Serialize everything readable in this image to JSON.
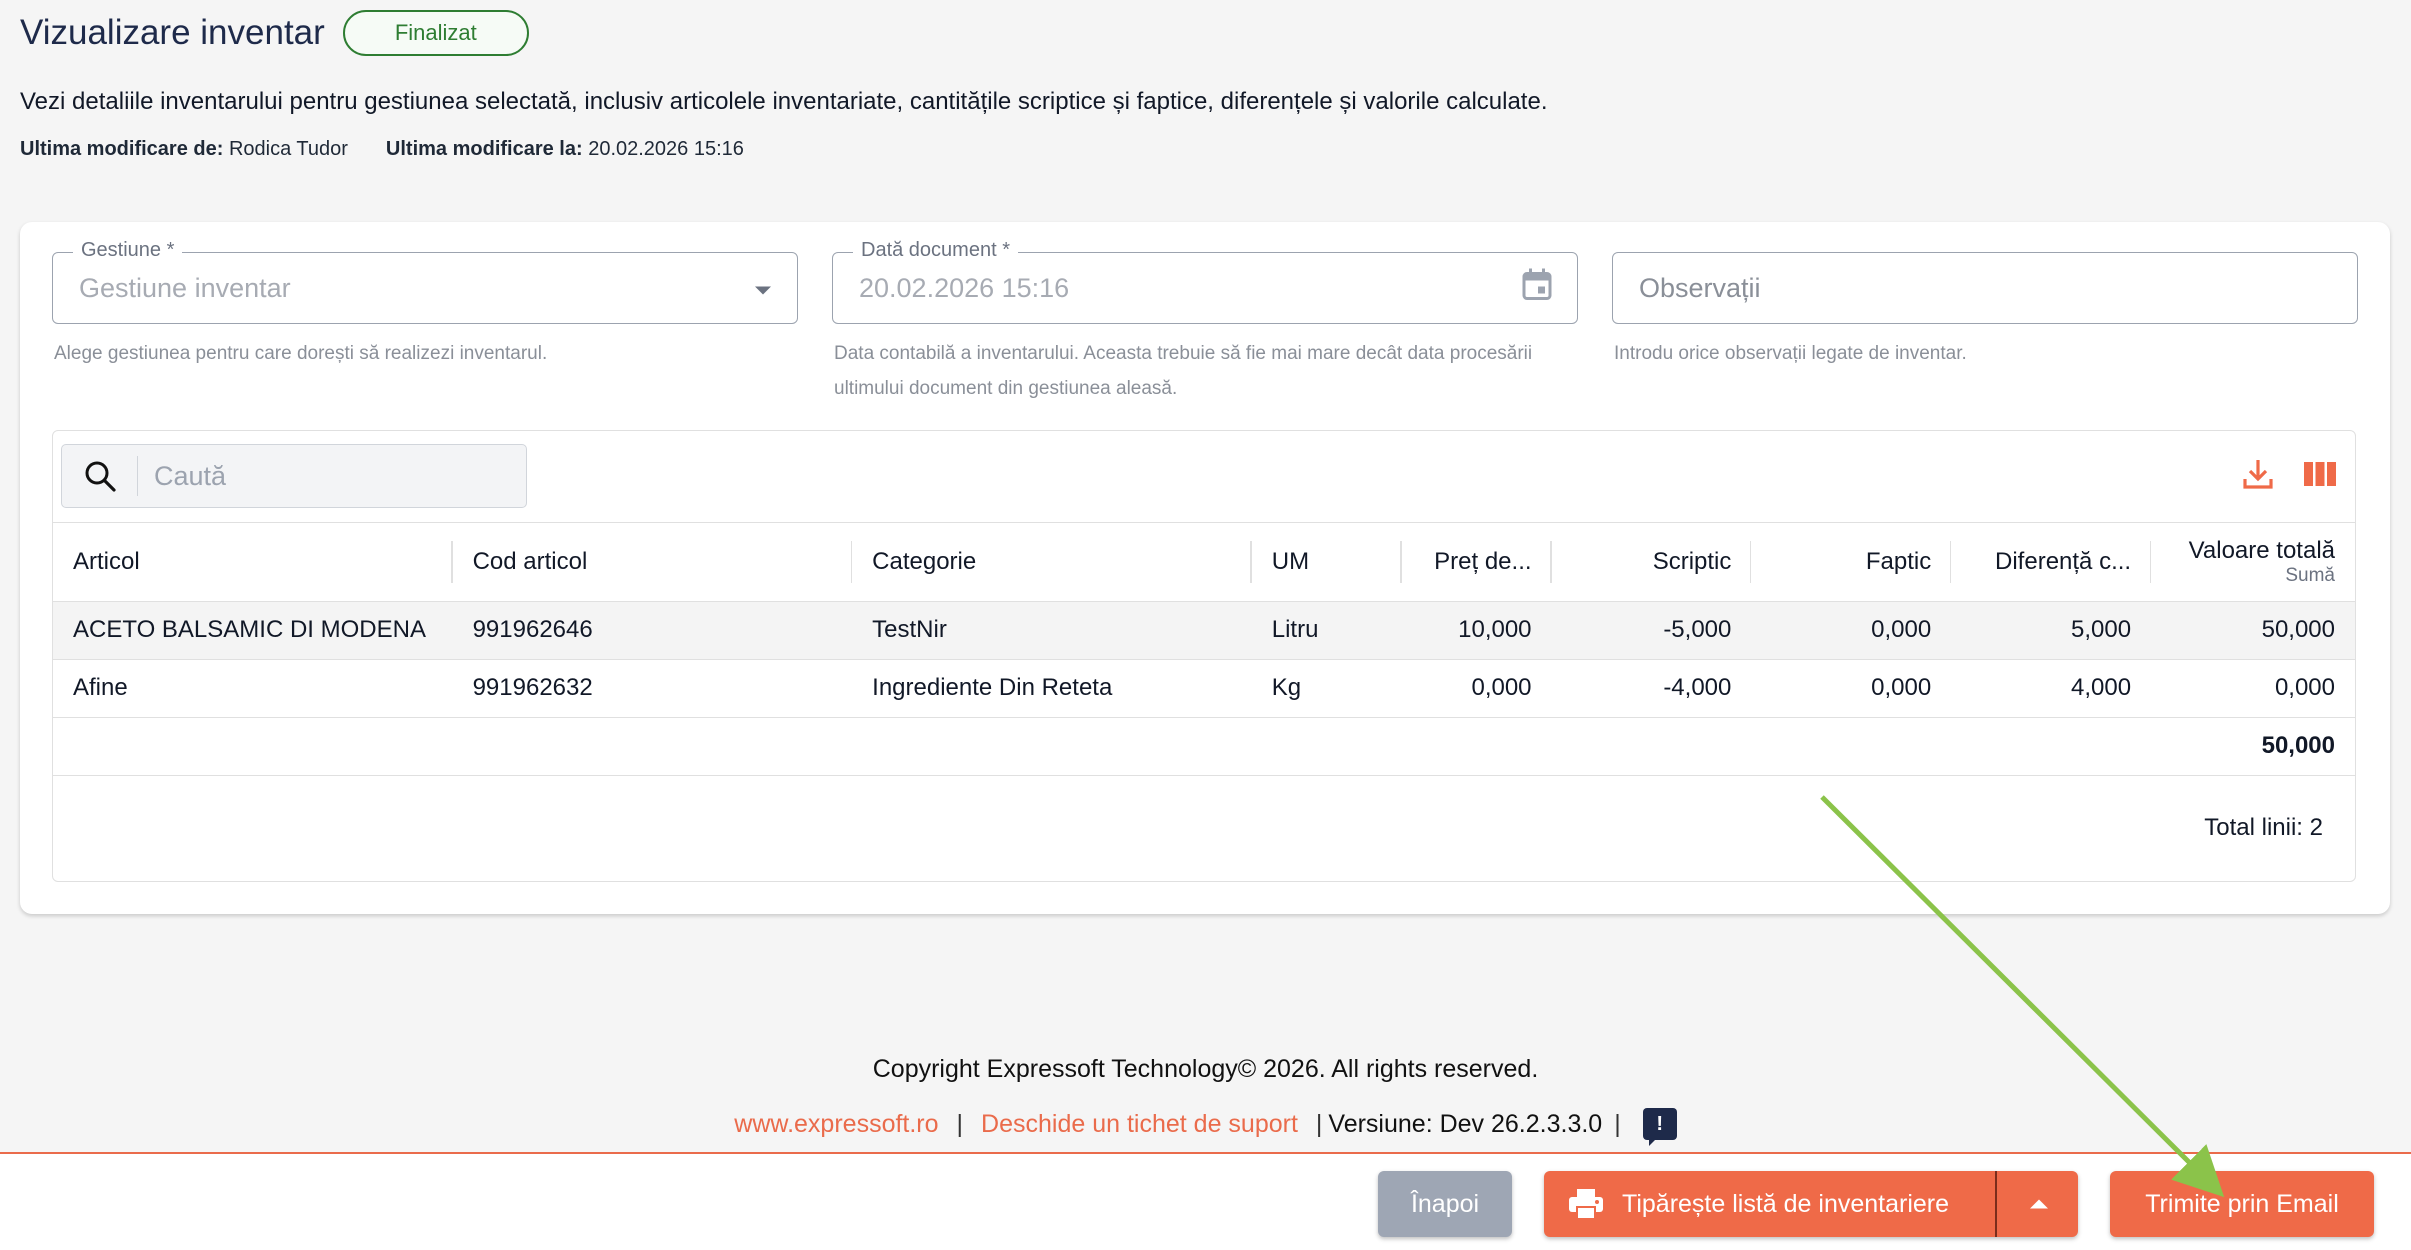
{
  "header": {
    "title": "Vizualizare inventar",
    "status": "Finalizat",
    "description": "Vezi detaliile inventarului pentru gestiunea selectată, inclusiv articolele inventariate, cantitățile scriptice și faptice, diferențele și valorile calculate.",
    "modified_by_label": "Ultima modificare de:",
    "modified_by": "Rodica Tudor",
    "modified_at_label": "Ultima modificare la:",
    "modified_at": "20.02.2026 15:16"
  },
  "form": {
    "gestiune": {
      "label": "Gestiune *",
      "value": "Gestiune inventar",
      "helper": "Alege gestiunea pentru care dorești să realizezi inventarul."
    },
    "data_document": {
      "label": "Dată document *",
      "value": "20.02.2026 15:16",
      "helper": "Data contabilă a inventarului. Aceasta trebuie să fie mai mare decât data procesării ultimului document din gestiunea aleasă."
    },
    "observatii": {
      "placeholder": "Observații",
      "helper": "Introdu orice observații legate de inventar."
    }
  },
  "grid": {
    "search_placeholder": "Caută",
    "columns": [
      "Articol",
      "Cod articol",
      "Categorie",
      "UM",
      "Preț de...",
      "Scriptic",
      "Faptic",
      "Diferență c...",
      "Valoare totală"
    ],
    "last_column_sub": "Sumă",
    "rows": [
      [
        "ACETO BALSAMIC DI MODENA",
        "991962646",
        "TestNir",
        "Litru",
        "10,000",
        "-5,000",
        "0,000",
        "5,000",
        "50,000"
      ],
      [
        "Afine",
        "991962632",
        "Ingrediente Din Reteta",
        "Kg",
        "0,000",
        "-4,000",
        "0,000",
        "4,000",
        "0,000"
      ]
    ],
    "total_value": "50,000",
    "total_lines": "Total linii: 2"
  },
  "footer": {
    "copyright": "Copyright Expressoft Technology© 2026. All rights reserved.",
    "site_link": "www.expressoft.ro",
    "support_link": "Deschide un tichet de suport",
    "version": "Versiune: Dev 26.2.3.3.0",
    "feedback_glyph": "!"
  },
  "actions": {
    "back": "Înapoi",
    "print": "Tipărește listă de inventariere",
    "email": "Trimite prin Email"
  },
  "colors": {
    "accent": "#ef6a48",
    "success": "#2e7d32",
    "arrow": "#8bc34a"
  }
}
